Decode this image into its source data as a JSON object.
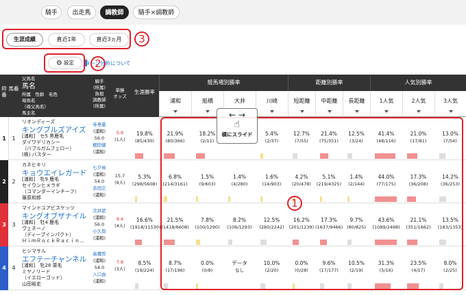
{
  "top_tabs": [
    "騎手",
    "出走馬",
    "調教師",
    "騎手×調教師"
  ],
  "active_top_tab": "調教師",
  "sub_tabs": [
    "生涯成績",
    "直近1年",
    "直近3ヵ月"
  ],
  "markers": {
    "one": "1",
    "two": "2",
    "three": "3"
  },
  "settings": {
    "label": "設定",
    "icon": "gear-icon"
  },
  "turn_link": "ターン分析について",
  "slide_hint": {
    "label": "横にスライド",
    "arrows": "← →",
    "icon": "hand-pointer-icon"
  },
  "header": {
    "waku": "枠番",
    "uma": "馬番",
    "pedigree": [
      "父馬名",
      "馬名",
      "所属　性齢　毛色",
      "母馬名",
      "（母父馬名）",
      "馬主名"
    ],
    "jockey": [
      "騎手",
      "(所属)",
      "負担",
      "調教師",
      "(所属)"
    ],
    "odds": [
      "単勝",
      "オッズ"
    ],
    "career": "生涯勝率",
    "group_venue": "競馬場別勝率",
    "group_distance": "距離別勝率",
    "group_pop": "人気別勝率",
    "venues": [
      "浦和",
      "船橋",
      "大井",
      "川崎"
    ],
    "distances": [
      "短距離",
      "中距離",
      "長距離"
    ],
    "pops": [
      "1人気",
      "2人気",
      "3人気"
    ]
  },
  "rows": [
    {
      "waku": "1",
      "uma": "1",
      "color": "#ffffff",
      "waku_text": "#222222",
      "sire": "リオンディーズ",
      "name": "キングブルズアイズ",
      "line2": "[浦和]　セ5 黒鹿毛",
      "dam": "ダイワデリカシー",
      "damsire": "（バブルガムフェロー）",
      "owner": "(株) バスター",
      "jockey": "寺島憂",
      "jockey_aff": "(浦和)",
      "weight": "56.0",
      "trainer": "棚田健",
      "trainer_aff": "(浦和)",
      "odds": "5.9",
      "pop": "(1人)",
      "odds_red": true,
      "career": [
        "19.8%",
        "(85/430)"
      ],
      "venues": [
        [
          "21.9%",
          "(80/366)"
        ],
        [
          "18.2%",
          "(2/11)"
        ],
        [
          "",
          ""
        ],
        [
          "5.4%",
          "(2/37)"
        ]
      ],
      "distances": [
        [
          "12.7%",
          "(7/55)"
        ],
        [
          "21.4%",
          "(75/351)"
        ],
        [
          "12.5%",
          "(3/24)"
        ]
      ],
      "pops": [
        [
          "41.4%",
          "(48/116)"
        ],
        [
          "21.0%",
          "(17/81)"
        ],
        [
          "13.0%",
          "(7/54)"
        ]
      ]
    },
    {
      "waku": "2",
      "uma": "2",
      "color": "#222222",
      "waku_text": "#ffffff",
      "sire": "カネヒキリ",
      "name": "キョウエイレガード",
      "line2": "[浦和]　牝9 鹿毛",
      "dam": "セイウンヒメラギ",
      "damsire": "（コマンダーインチーフ）",
      "owner": "篠原和郎",
      "jockey": "七夕裕",
      "jockey_aff": "(浦和)",
      "weight": "54.0",
      "trainer": "吉田正",
      "trainer_aff": "(浦和)",
      "odds": "15.7",
      "pop": "(9人)",
      "odds_red": false,
      "career": [
        "5.3%",
        "(298/5608)"
      ],
      "venues": [
        [
          "6.8%",
          "(214/3161)"
        ],
        [
          "1.5%",
          "(9/603)"
        ],
        [
          "1.4%",
          "(4/280)"
        ],
        [
          "1.6%",
          "(14/903)"
        ]
      ],
      "distances": [
        [
          "4.2%",
          "(20/478)"
        ],
        [
          "5.1%",
          "(219/4325)"
        ],
        [
          "1.4%",
          "(2/144)"
        ]
      ],
      "pops": [
        [
          "44.0%",
          "(77/175)"
        ],
        [
          "17.3%",
          "(36/208)"
        ],
        [
          "14.2%",
          "(36/253)"
        ]
      ]
    },
    {
      "waku": "3",
      "uma": "3",
      "color": "#e0303a",
      "waku_text": "#ffffff",
      "sire": "マインドユアビスケッツ",
      "name": "キングオブザナイル",
      "line2": "[浦和]　牡4 鹿毛",
      "dam": "ヴェネーノ",
      "damsire": "（ディープインパクト）",
      "owner": "ＨｉｍＲｏｃｋＲａｃｉｎ…",
      "jockey": "次井武",
      "jockey_aff": "(浦和)",
      "weight": "56.0",
      "trainer": "小久智",
      "trainer_aff": "(浦和)",
      "odds": "9.4",
      "pop": "(4人)",
      "odds_red": true,
      "career": [
        "16.6%",
        "(1918/11530)"
      ],
      "venues": [
        [
          "21.5%",
          "(1418/6608)"
        ],
        [
          "7.8%",
          "(100/1290)"
        ],
        [
          "8.2%",
          "(106/1293)"
        ],
        [
          "12.5%",
          "(280/2242)"
        ]
      ],
      "distances": [
        [
          "16.2%",
          "(201/1239)"
        ],
        [
          "17.3%",
          "(1637/9466)"
        ],
        [
          "9.7%",
          "(80/825)"
        ]
      ],
      "pops": [
        [
          "43.6%",
          "(1089/2498)"
        ],
        [
          "21.1%",
          "(351/1662)"
        ],
        [
          "13.5%",
          "(183/1353)"
        ]
      ]
    },
    {
      "waku": "4",
      "uma": "4",
      "color": "#2a5fc8",
      "waku_text": "#ffffff",
      "sire": "ヒシマサル",
      "name": "エフテーチャンネル",
      "line2": "[浦和]　牝28 栗毛",
      "dam": "ミヤノリード",
      "damsire": "（イエローゴッド）",
      "owner": "山田裕史",
      "jockey": "高橋哲",
      "jockey_aff": "(浦和)",
      "weight": "54.0",
      "trainer": "入口由",
      "trainer_aff": "(浦和)",
      "odds": "7.8",
      "pop": "(3人)",
      "odds_red": true,
      "career": [
        "8.5%",
        "(19/224)"
      ],
      "venues": [
        [
          "8.7%",
          "(17/196)"
        ],
        [
          "0.0%",
          "(0/8)"
        ],
        [
          "データ",
          "なし"
        ],
        [
          "10.0%",
          "(2/20)"
        ]
      ],
      "distances": [
        [
          "0.0%",
          "(0/28)"
        ],
        [
          "9.6%",
          "(17/177)"
        ],
        [
          "10.5%",
          "(2/19)"
        ]
      ],
      "pops": [
        [
          "31.3%",
          "(5/16)"
        ],
        [
          "23.5%",
          "(4/17)"
        ],
        [
          "8.0%",
          "(2/25)"
        ]
      ]
    }
  ],
  "colors": {
    "red_bar": "#f09090",
    "blue_bar": "#8aa8e8",
    "gray_bar": "#dddddd",
    "yellow_bar": "#f5e08a",
    "link": "#2070c8",
    "marker": "#e0202a"
  }
}
